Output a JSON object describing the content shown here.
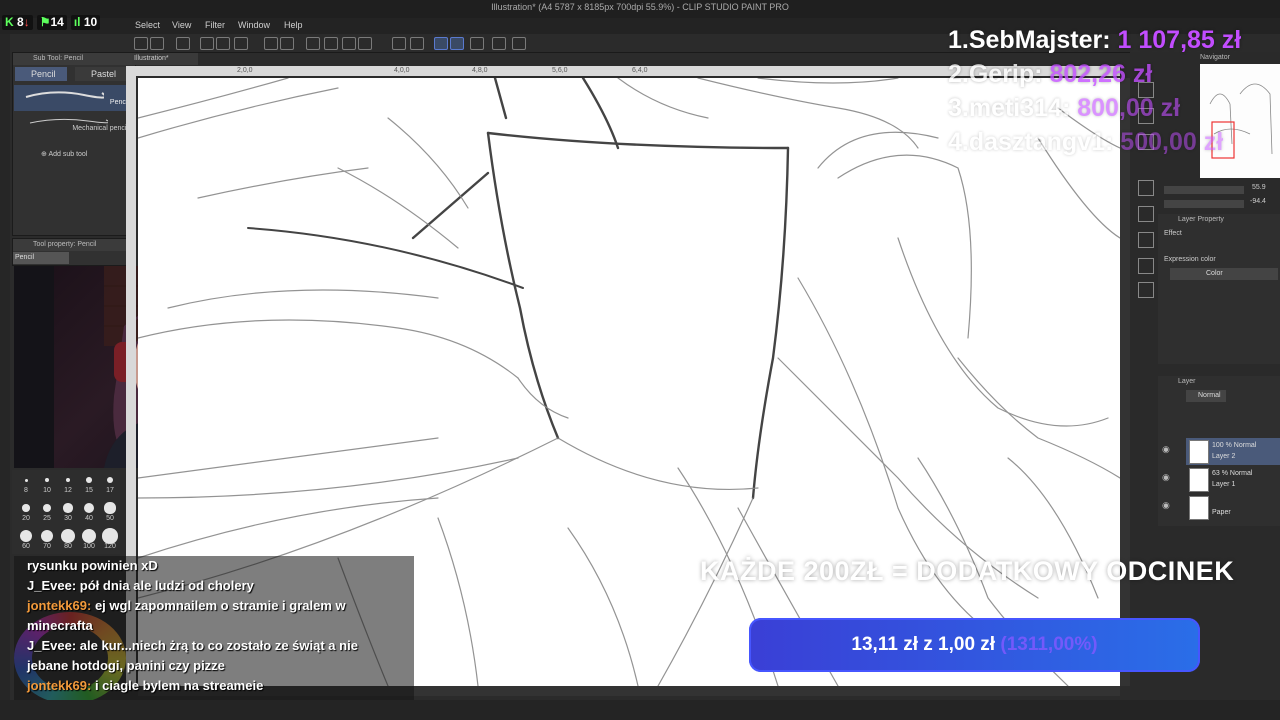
{
  "window": {
    "title": "Illustration* (A4 5787 x 8185px 700dpi 55.9%) - CLIP STUDIO PAINT PRO"
  },
  "stats": [
    {
      "label": "8",
      "color": "#ff4d4d",
      "icon": "kick-icon"
    },
    {
      "label": "14",
      "color": "#5dff5d",
      "icon": "follower-icon"
    },
    {
      "label": "10",
      "color": "#5dff5d",
      "icon": "viewers-icon"
    }
  ],
  "menu": [
    "Select",
    "View",
    "Filter",
    "Window",
    "Help"
  ],
  "doc_tab": "Illustration*",
  "ruler_ticks": [
    "2,0,0",
    "4,0,0",
    "4,8,0",
    "5,6,0",
    "6,4,0"
  ],
  "subtool": {
    "title": "Sub Tool: Pencil",
    "tabs": [
      "Pencil",
      "Pastel"
    ],
    "brushes": [
      "Pencil",
      "Mechanical pencil"
    ],
    "add_label": "Add sub tool"
  },
  "tool_property": {
    "title": "Tool property: Pencil",
    "tag": "Pencil"
  },
  "brush_sizes": [
    "8",
    "10",
    "12",
    "15",
    "17",
    "20",
    "25",
    "30",
    "40",
    "50",
    "60",
    "70",
    "80",
    "100",
    "120"
  ],
  "navigator": {
    "title": "Navigator",
    "zoom": "55.9",
    "angle": "-94.4"
  },
  "layer_property": {
    "title": "Layer Property",
    "effect": "Effect",
    "expression_label": "Expression color",
    "expression_value": "Color"
  },
  "layers_panel": {
    "title": "Layer",
    "blend": "Normal",
    "layers": [
      {
        "mode": "100 % Normal",
        "name": "Layer 2"
      },
      {
        "mode": "63 % Normal",
        "name": "Layer 1"
      },
      {
        "mode": "",
        "name": "Paper"
      }
    ]
  },
  "donors": [
    {
      "rank_name": "1.SebMajster:",
      "amount": "1 107,85 zł"
    },
    {
      "rank_name": "2.Gerip:",
      "amount": "802,26 zł"
    },
    {
      "rank_name": "3.meti314:",
      "amount": "800,00 zł"
    },
    {
      "rank_name": "4.dasztangv1:",
      "amount": "500,00 zł"
    }
  ],
  "banner": "KAŻDE 200ZŁ = DODATKOWY ODCINEK",
  "goal": {
    "current": "13,11 zł",
    "sep": "z",
    "target": "1,00 zł",
    "percent": "(1311,00%)",
    "accent": "#3a3fd6"
  },
  "chat": [
    {
      "user": "",
      "text": "rysunku powinien xD",
      "user_color": "#ffffff"
    },
    {
      "user": "J_Evee:",
      "text": "pół dnia ale ludzi od cholery",
      "user_color": "#ffffff"
    },
    {
      "user": "jontekk69:",
      "text": "ej wgl zapomnailem o stramie i gralem w",
      "user_color": "#f29a3b"
    },
    {
      "user": "",
      "text": "minecrafta",
      "user_color": "#ffffff"
    },
    {
      "user": "J_Evee:",
      "text": "ale kur...niech żrą to co zostało ze świąt a nie",
      "user_color": "#ffffff"
    },
    {
      "user": "",
      "text": "jebane hotdogi, panini czy pizze",
      "user_color": "#ffffff"
    },
    {
      "user": "jontekk69:",
      "text": "i ciagle bylem na streameie",
      "user_color": "#f29a3b"
    }
  ]
}
